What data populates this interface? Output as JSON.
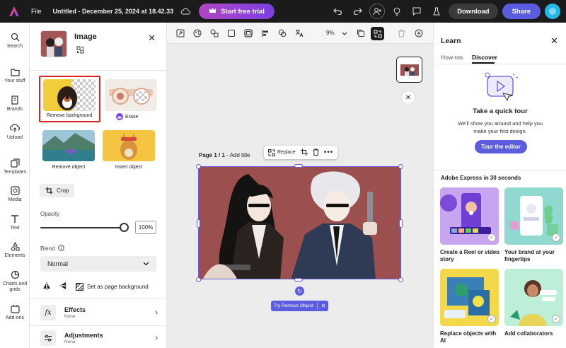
{
  "topbar": {
    "file_label": "File",
    "doc_title": "Untitled - December 25, 2024 at 18.42.33",
    "trial_label": "Start free trial",
    "download_label": "Download",
    "share_label": "Share"
  },
  "rail": {
    "items": [
      {
        "label": "Search",
        "icon": "search-icon"
      },
      {
        "label": "Your stuff",
        "icon": "folder-icon"
      },
      {
        "label": "Brands",
        "icon": "brand-icon"
      },
      {
        "label": "Upload",
        "icon": "upload-icon"
      },
      {
        "label": "Templates",
        "icon": "templates-icon"
      },
      {
        "label": "Media",
        "icon": "media-icon"
      },
      {
        "label": "Text",
        "icon": "text-icon"
      },
      {
        "label": "Elements",
        "icon": "elements-icon"
      },
      {
        "label": "Charts and grids",
        "icon": "charts-icon"
      },
      {
        "label": "Add-ons",
        "icon": "addons-icon"
      }
    ]
  },
  "panel": {
    "title": "Image",
    "tiles": [
      {
        "label": "Remove background"
      },
      {
        "label": "Erase"
      },
      {
        "label": "Remove object"
      },
      {
        "label": "Insert object"
      }
    ],
    "crop_label": "Crop",
    "opacity_label": "Opacity",
    "opacity_value": "100%",
    "opacity_level": 1.0,
    "blend_label": "Blend",
    "blend_value": "Normal",
    "page_bg_label": "Set as page background",
    "effects": {
      "title": "Effects",
      "sub": "None"
    },
    "adjustments": {
      "title": "Adjustments",
      "sub": "None"
    }
  },
  "canvas": {
    "zoom": "9%",
    "page_label_bold": "Page 1 / 1",
    "page_label_rest": " - Add title",
    "replace_label": "Replace",
    "try_label": "Try Remove Object"
  },
  "learn": {
    "title": "Learn",
    "tabs": [
      "How-tos",
      "Discover"
    ],
    "active_tab": "Discover",
    "tour_title": "Take a quick tour",
    "tour_text": "We'll show you around and help you make your first design.",
    "tour_button": "Tour the editor",
    "section_title": "Adobe Express in 30 seconds",
    "cards": [
      {
        "label": "Create a Reel or video story"
      },
      {
        "label": "Your brand at your fingertips"
      },
      {
        "label": "Replace objects with AI"
      },
      {
        "label": "Add collaborators"
      }
    ]
  },
  "colors": {
    "accent": "#5c5ce0",
    "selection_outline": "#dd2222",
    "topbar_bg": "#1b1b1b",
    "artwork_bg": "#9c4f4f"
  }
}
